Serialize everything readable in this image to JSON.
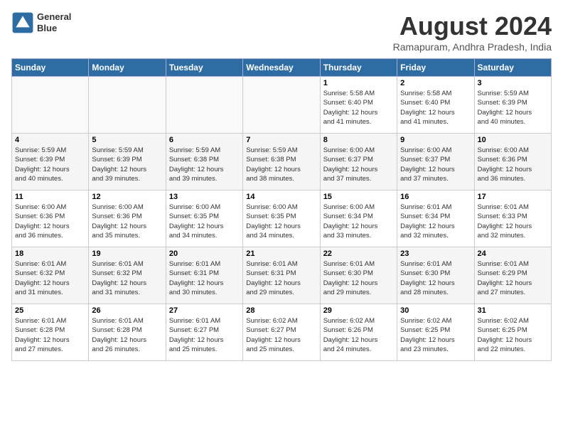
{
  "header": {
    "logo_line1": "General",
    "logo_line2": "Blue",
    "title": "August 2024",
    "subtitle": "Ramapuram, Andhra Pradesh, India"
  },
  "days_of_week": [
    "Sunday",
    "Monday",
    "Tuesday",
    "Wednesday",
    "Thursday",
    "Friday",
    "Saturday"
  ],
  "weeks": [
    [
      {
        "num": "",
        "detail": ""
      },
      {
        "num": "",
        "detail": ""
      },
      {
        "num": "",
        "detail": ""
      },
      {
        "num": "",
        "detail": ""
      },
      {
        "num": "1",
        "detail": "Sunrise: 5:58 AM\nSunset: 6:40 PM\nDaylight: 12 hours\nand 41 minutes."
      },
      {
        "num": "2",
        "detail": "Sunrise: 5:58 AM\nSunset: 6:40 PM\nDaylight: 12 hours\nand 41 minutes."
      },
      {
        "num": "3",
        "detail": "Sunrise: 5:59 AM\nSunset: 6:39 PM\nDaylight: 12 hours\nand 40 minutes."
      }
    ],
    [
      {
        "num": "4",
        "detail": "Sunrise: 5:59 AM\nSunset: 6:39 PM\nDaylight: 12 hours\nand 40 minutes."
      },
      {
        "num": "5",
        "detail": "Sunrise: 5:59 AM\nSunset: 6:39 PM\nDaylight: 12 hours\nand 39 minutes."
      },
      {
        "num": "6",
        "detail": "Sunrise: 5:59 AM\nSunset: 6:38 PM\nDaylight: 12 hours\nand 39 minutes."
      },
      {
        "num": "7",
        "detail": "Sunrise: 5:59 AM\nSunset: 6:38 PM\nDaylight: 12 hours\nand 38 minutes."
      },
      {
        "num": "8",
        "detail": "Sunrise: 6:00 AM\nSunset: 6:37 PM\nDaylight: 12 hours\nand 37 minutes."
      },
      {
        "num": "9",
        "detail": "Sunrise: 6:00 AM\nSunset: 6:37 PM\nDaylight: 12 hours\nand 37 minutes."
      },
      {
        "num": "10",
        "detail": "Sunrise: 6:00 AM\nSunset: 6:36 PM\nDaylight: 12 hours\nand 36 minutes."
      }
    ],
    [
      {
        "num": "11",
        "detail": "Sunrise: 6:00 AM\nSunset: 6:36 PM\nDaylight: 12 hours\nand 36 minutes."
      },
      {
        "num": "12",
        "detail": "Sunrise: 6:00 AM\nSunset: 6:36 PM\nDaylight: 12 hours\nand 35 minutes."
      },
      {
        "num": "13",
        "detail": "Sunrise: 6:00 AM\nSunset: 6:35 PM\nDaylight: 12 hours\nand 34 minutes."
      },
      {
        "num": "14",
        "detail": "Sunrise: 6:00 AM\nSunset: 6:35 PM\nDaylight: 12 hours\nand 34 minutes."
      },
      {
        "num": "15",
        "detail": "Sunrise: 6:00 AM\nSunset: 6:34 PM\nDaylight: 12 hours\nand 33 minutes."
      },
      {
        "num": "16",
        "detail": "Sunrise: 6:01 AM\nSunset: 6:34 PM\nDaylight: 12 hours\nand 32 minutes."
      },
      {
        "num": "17",
        "detail": "Sunrise: 6:01 AM\nSunset: 6:33 PM\nDaylight: 12 hours\nand 32 minutes."
      }
    ],
    [
      {
        "num": "18",
        "detail": "Sunrise: 6:01 AM\nSunset: 6:32 PM\nDaylight: 12 hours\nand 31 minutes."
      },
      {
        "num": "19",
        "detail": "Sunrise: 6:01 AM\nSunset: 6:32 PM\nDaylight: 12 hours\nand 31 minutes."
      },
      {
        "num": "20",
        "detail": "Sunrise: 6:01 AM\nSunset: 6:31 PM\nDaylight: 12 hours\nand 30 minutes."
      },
      {
        "num": "21",
        "detail": "Sunrise: 6:01 AM\nSunset: 6:31 PM\nDaylight: 12 hours\nand 29 minutes."
      },
      {
        "num": "22",
        "detail": "Sunrise: 6:01 AM\nSunset: 6:30 PM\nDaylight: 12 hours\nand 29 minutes."
      },
      {
        "num": "23",
        "detail": "Sunrise: 6:01 AM\nSunset: 6:30 PM\nDaylight: 12 hours\nand 28 minutes."
      },
      {
        "num": "24",
        "detail": "Sunrise: 6:01 AM\nSunset: 6:29 PM\nDaylight: 12 hours\nand 27 minutes."
      }
    ],
    [
      {
        "num": "25",
        "detail": "Sunrise: 6:01 AM\nSunset: 6:28 PM\nDaylight: 12 hours\nand 27 minutes."
      },
      {
        "num": "26",
        "detail": "Sunrise: 6:01 AM\nSunset: 6:28 PM\nDaylight: 12 hours\nand 26 minutes."
      },
      {
        "num": "27",
        "detail": "Sunrise: 6:01 AM\nSunset: 6:27 PM\nDaylight: 12 hours\nand 25 minutes."
      },
      {
        "num": "28",
        "detail": "Sunrise: 6:02 AM\nSunset: 6:27 PM\nDaylight: 12 hours\nand 25 minutes."
      },
      {
        "num": "29",
        "detail": "Sunrise: 6:02 AM\nSunset: 6:26 PM\nDaylight: 12 hours\nand 24 minutes."
      },
      {
        "num": "30",
        "detail": "Sunrise: 6:02 AM\nSunset: 6:25 PM\nDaylight: 12 hours\nand 23 minutes."
      },
      {
        "num": "31",
        "detail": "Sunrise: 6:02 AM\nSunset: 6:25 PM\nDaylight: 12 hours\nand 22 minutes."
      }
    ]
  ]
}
